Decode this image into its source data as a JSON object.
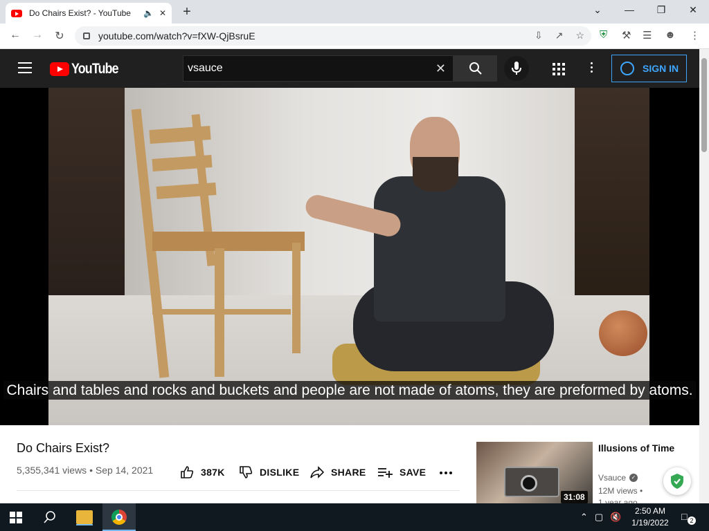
{
  "browser": {
    "tab_title": "Do Chairs Exist? - YouTube",
    "url": "youtube.com/watch?v=fXW-QjBsruE",
    "extension_badge": "on"
  },
  "youtube": {
    "logo_text": "YouTube",
    "search_value": "vsauce",
    "sign_in_label": "SIGN IN"
  },
  "video": {
    "caption": "Chairs and tables and rocks and buckets and people are not made of atoms, they are preformed by atoms.",
    "title": "Do Chairs Exist?",
    "views": "5,355,341 views",
    "date": "Sep 14, 2021",
    "meta_separator": "•",
    "likes": "387K",
    "dislike_label": "DISLIKE",
    "share_label": "SHARE",
    "save_label": "SAVE"
  },
  "recommended": {
    "title": "Illusions of Time",
    "channel": "Vsauce",
    "views": "12M views •",
    "age": "1 year ago",
    "duration": "31:08"
  },
  "taskbar": {
    "time": "2:50 AM",
    "date": "1/19/2022",
    "notification_count": "2"
  },
  "colors": {
    "youtube_red": "#ff0000",
    "header_bg": "#202020",
    "signin_blue": "#3ea6ff",
    "taskbar_bg": "#101820"
  }
}
